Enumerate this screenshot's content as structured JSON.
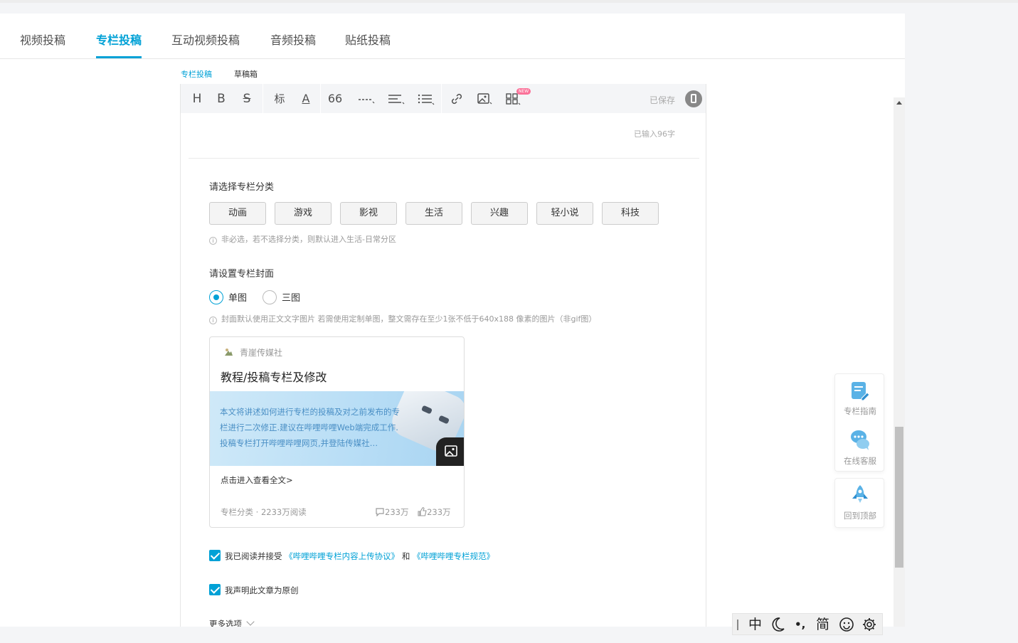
{
  "tabs": [
    "视频投稿",
    "专栏投稿",
    "互动视频投稿",
    "音频投稿",
    "贴纸投稿"
  ],
  "subtabs": [
    "专栏投稿",
    "草稿箱"
  ],
  "toolbar": {
    "heading": "H",
    "bold": "B",
    "strike": "S",
    "title_menu": "标",
    "font_color": "A",
    "quote": "66",
    "new_badge": "NEW",
    "saved": "已保存"
  },
  "word_count": "已输入96字",
  "category": {
    "label": "请选择专栏分类",
    "options": [
      "动画",
      "游戏",
      "影视",
      "生活",
      "兴趣",
      "轻小说",
      "科技"
    ],
    "hint": "非必选，若不选择分类，则默认进入生活-日常分区"
  },
  "cover": {
    "label": "请设置专栏封面",
    "options": [
      "单图",
      "三图"
    ],
    "selected": "单图",
    "hint": "封面默认使用正文文字图片 若需使用定制单图，整文需存在至少1张不低于640x188 像素的图片（非gif图）"
  },
  "preview": {
    "author": "青崖传媒社",
    "title": "教程/投稿专栏及修改",
    "description": "本文将讲述如何进行专栏的投稿及对之前发布的专栏进行二次修正.建议在哔哩哔哩Web端完成工作.投稿专栏打开哔哩哔哩网页,并登陆传媒社…",
    "read_more": "点击进入查看全文>",
    "meta": "专栏分类 · 2233万阅读",
    "comments": "233万",
    "likes": "233万"
  },
  "agreement": {
    "prefix": "我已阅读并接受",
    "link1": "《哔哩哔哩专栏内容上传协议》",
    "and": "和",
    "link2": "《哔哩哔哩专栏规范》",
    "checked": true
  },
  "original": {
    "text": "我声明此文章为原创",
    "checked": true
  },
  "more_options": "更多选项",
  "sidebar": {
    "guide": "专栏指南",
    "service": "在线客服",
    "top": "回到顶部"
  },
  "ime": {
    "lang": "中",
    "punct": "•,",
    "simplified": "简"
  },
  "colors": {
    "accent": "#00a1d6",
    "badge": "#fb7299",
    "text": "#212121",
    "muted": "#999999"
  }
}
